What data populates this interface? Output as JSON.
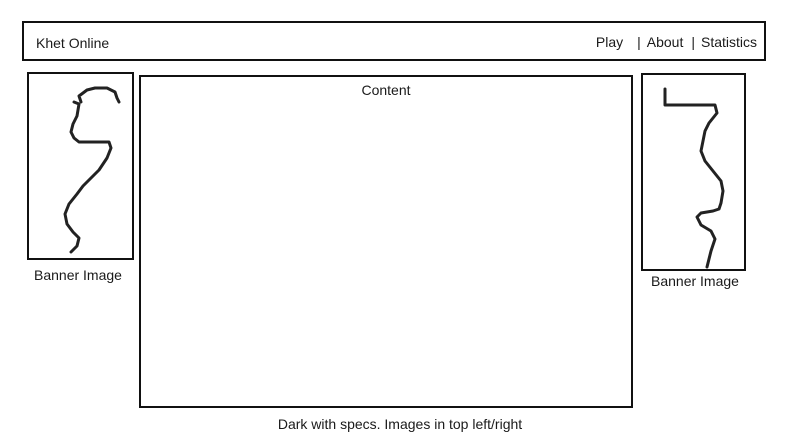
{
  "header": {
    "title": "Khet Online",
    "nav": [
      {
        "label": "Play"
      },
      {
        "label": "About"
      },
      {
        "label": "Statistics"
      }
    ],
    "separator": "|"
  },
  "banners": {
    "left": {
      "caption": "Banner Image"
    },
    "right": {
      "caption": "Banner Image"
    }
  },
  "content": {
    "label": "Content"
  },
  "footer": {
    "note": "Dark with specs. Images in top left/right"
  }
}
